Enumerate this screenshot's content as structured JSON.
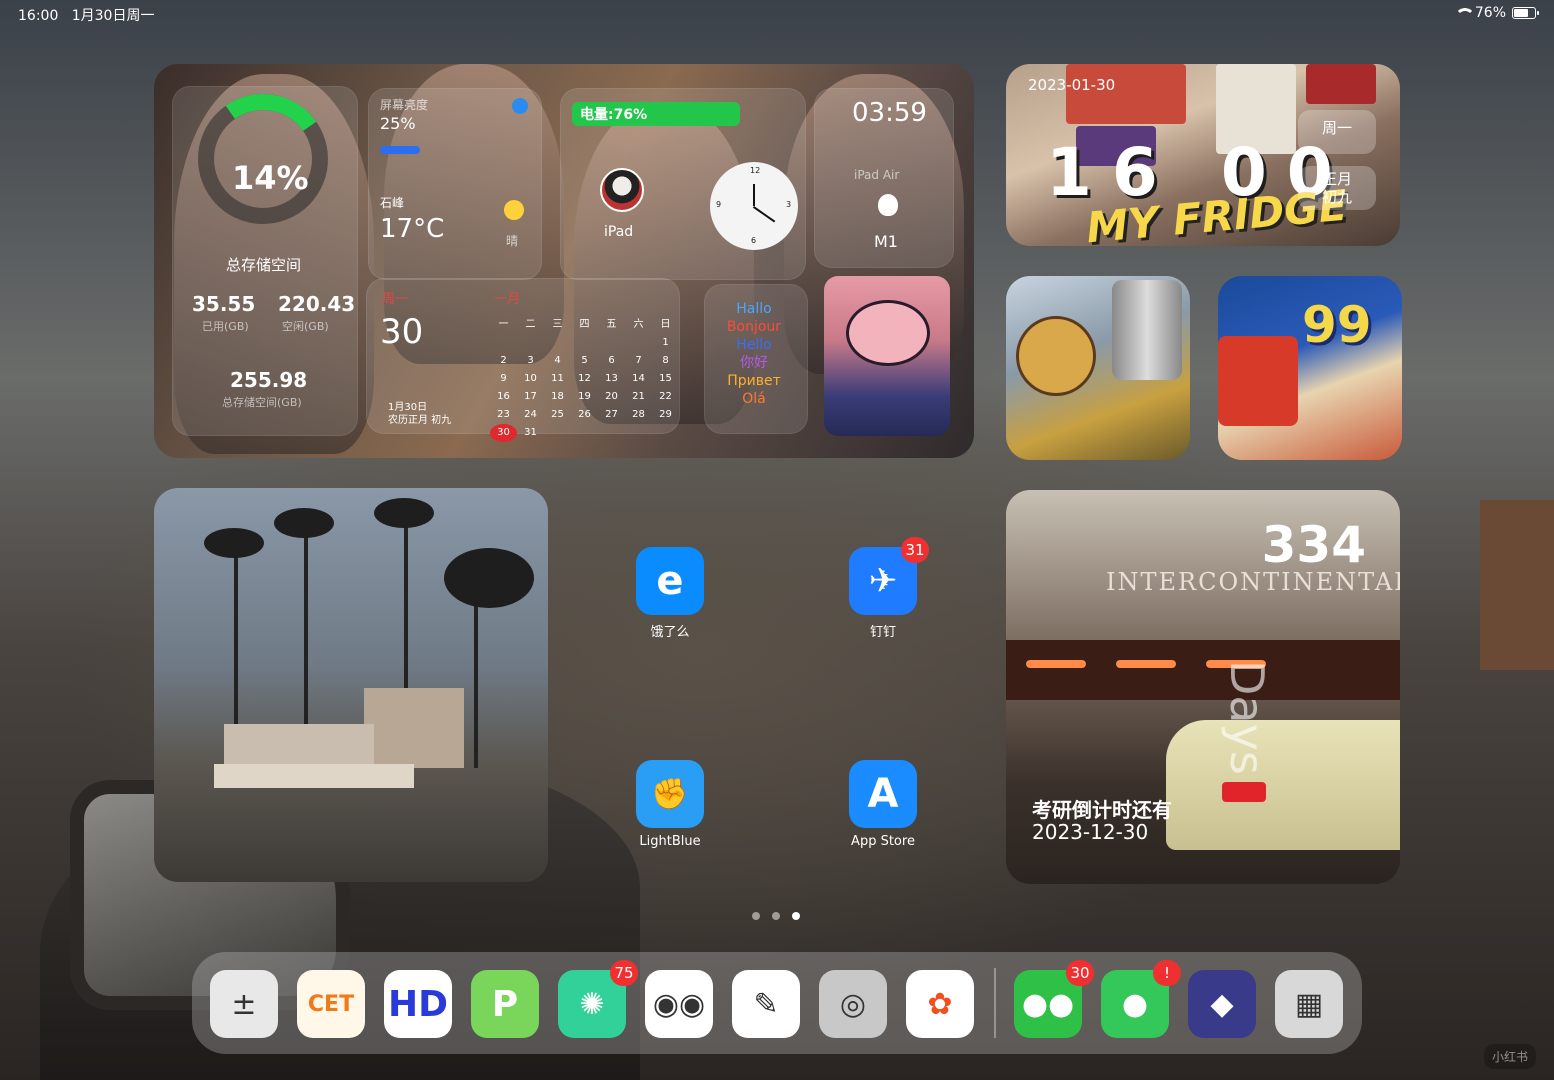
{
  "status_bar": {
    "time": "16:00",
    "date": "1月30日周一",
    "battery": "76%",
    "battery_level": 0.76
  },
  "storage_widget": {
    "percent": "14%",
    "title": "总存储空间",
    "used_value": "35.55",
    "used_label": "已用(GB)",
    "free_value": "220.43",
    "free_label": "空闲(GB)",
    "total_value": "255.98",
    "total_label": "总存储空间(GB)"
  },
  "brightness_widget": {
    "label": "屏幕亮度",
    "value": "25%",
    "level": 0.25
  },
  "weather_widget": {
    "location": "石峰",
    "temperature": "17°C",
    "condition": "晴"
  },
  "battery_widget": {
    "label": "电量:76%",
    "device": "iPad"
  },
  "clock_widget": {
    "numbers": [
      "12",
      "3",
      "6",
      "9"
    ]
  },
  "device_widget": {
    "time": "03:59",
    "model": "iPad Air",
    "chip": "M1"
  },
  "calendar_widget": {
    "weekday": "周一",
    "day": "30",
    "month": "一月",
    "date_line": "1月30日",
    "lunar_line": "农历正月 初九",
    "headers": [
      "一",
      "二",
      "三",
      "四",
      "五",
      "六",
      "日"
    ],
    "rows": [
      [
        "",
        "",
        "",
        "",
        "",
        "",
        "1"
      ],
      [
        "2",
        "3",
        "4",
        "5",
        "6",
        "7",
        "8"
      ],
      [
        "9",
        "10",
        "11",
        "12",
        "13",
        "14",
        "15"
      ],
      [
        "16",
        "17",
        "18",
        "19",
        "20",
        "21",
        "22"
      ],
      [
        "23",
        "24",
        "25",
        "26",
        "27",
        "28",
        "29"
      ],
      [
        "30",
        "31",
        "",
        "",
        "",
        "",
        ""
      ]
    ],
    "today": "30"
  },
  "hello_widget": {
    "words": [
      {
        "text": "Hallo",
        "color": "#4aa6ff"
      },
      {
        "text": "Bonjour",
        "color": "#ff4a3a"
      },
      {
        "text": "Hello",
        "color": "#3a6cff"
      },
      {
        "text": "你好",
        "color": "#b25ae8"
      },
      {
        "text": "Привет",
        "color": "#ffb02a"
      },
      {
        "text": "Olá",
        "color": "#ff7a2a"
      }
    ]
  },
  "fridge_widget": {
    "date": "2023-01-30",
    "hour": "16",
    "minute": "00",
    "text": "MY FRIDGE",
    "weekday": "周一",
    "lunar": "正月\n初九"
  },
  "apps": [
    {
      "name": "饿了么",
      "icon": "eleme-icon",
      "color": "#0a8cff"
    },
    {
      "name": "钉钉",
      "icon": "dingtalk-icon",
      "color": "#1f7bff",
      "badge": "31"
    },
    {
      "name": "LightBlue",
      "icon": "lightblue-icon",
      "color": "#2a9df4"
    },
    {
      "name": "App Store",
      "icon": "appstore-icon",
      "color": "#1a8cff"
    }
  ],
  "countdown_widget": {
    "number": "334",
    "unit": "Days",
    "title": "考研倒计时还有",
    "target": "2023-12-30",
    "sign": "INTERCONTINENTAL"
  },
  "page_dots": {
    "count": 3,
    "active": 2
  },
  "dock": {
    "apps": [
      {
        "icon": "calculator-icon",
        "color": "#e8e8e8"
      },
      {
        "icon": "cet-icon",
        "color": "#fff7e8",
        "label": "CET"
      },
      {
        "icon": "browser-icon",
        "color": "#ffffff",
        "label": "HD"
      },
      {
        "icon": "p-app-icon",
        "color": "#7ad65a",
        "label": "P"
      },
      {
        "icon": "speaker-app-icon",
        "color": "#33d19a",
        "badge": "75"
      },
      {
        "icon": "owl-icon",
        "color": "#ffffff"
      },
      {
        "icon": "notes-pen-icon",
        "color": "#ffffff"
      },
      {
        "icon": "camera-icon",
        "color": "#c8c8c8"
      },
      {
        "icon": "photos-icon",
        "color": "#ffffff"
      },
      {
        "icon": "wechat-icon",
        "color": "#2fc048",
        "badge": "30"
      },
      {
        "icon": "messages-icon",
        "color": "#34c759",
        "badge": "!"
      },
      {
        "icon": "shortcuts-icon",
        "color": "#3a3a8a"
      },
      {
        "icon": "app-library-icon",
        "color": "#d8d8d8"
      }
    ]
  },
  "watermark": "小红书"
}
